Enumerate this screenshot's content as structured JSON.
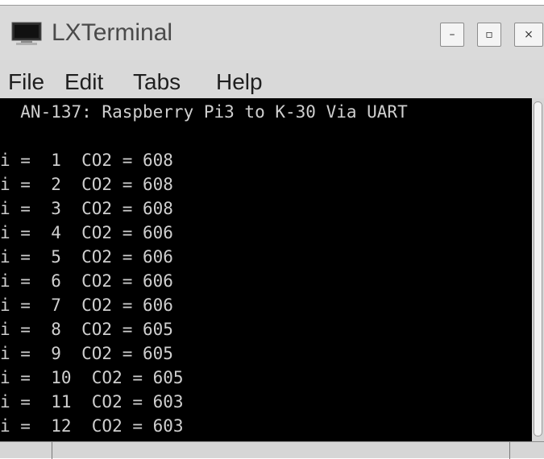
{
  "window": {
    "title": "LXTerminal",
    "icon": "terminal-monitor-icon",
    "controls": {
      "minimize": "–",
      "maximize": "▫",
      "close": "×"
    }
  },
  "menu": [
    "File",
    "Edit",
    "Tabs",
    "Help"
  ],
  "terminal": {
    "lines": [
      "  AN-137: Raspberry Pi3 to K-30 Via UART",
      "",
      "i =  1  CO2 = 608",
      "i =  2  CO2 = 608",
      "i =  3  CO2 = 608",
      "i =  4  CO2 = 606",
      "i =  5  CO2 = 606",
      "i =  6  CO2 = 606",
      "i =  7  CO2 = 606",
      "i =  8  CO2 = 605",
      "i =  9  CO2 = 605",
      "i =  10  CO2 = 605",
      "i =  11  CO2 = 603",
      "i =  12  CO2 = 603"
    ],
    "background": "#000000",
    "foreground": "#cfcfcf"
  }
}
